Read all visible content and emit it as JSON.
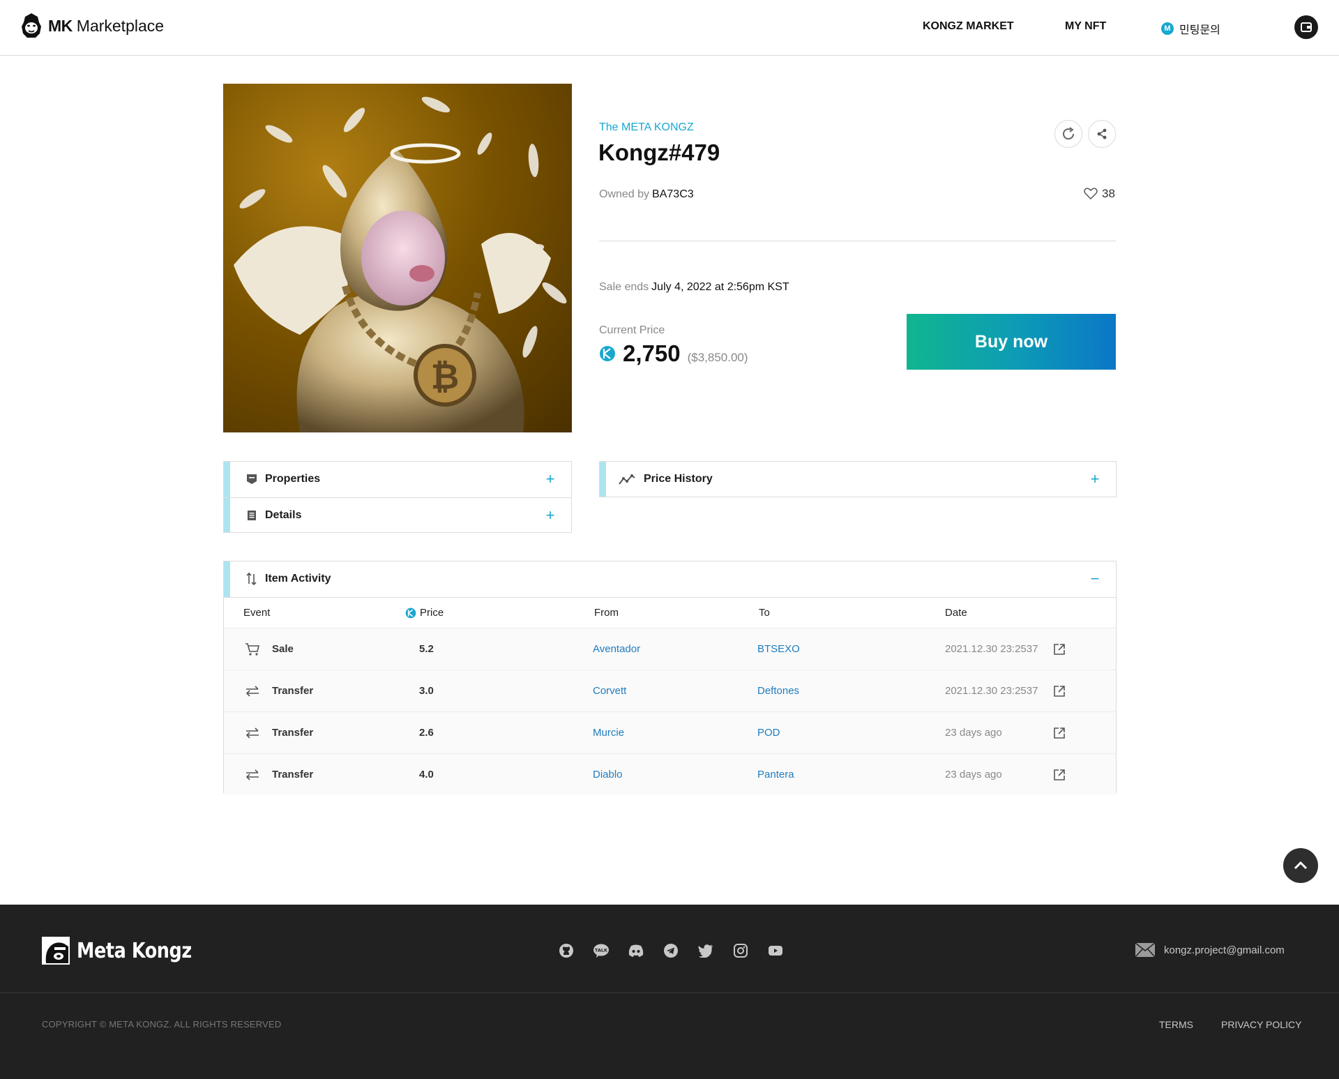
{
  "header": {
    "logo_bold": "MK",
    "logo_text": "Marketplace",
    "nav": {
      "market": "KONGZ MARKET",
      "my_nft": "MY NFT",
      "mint_badge": "M",
      "mint_inquiry": "민팅문의"
    }
  },
  "item": {
    "collection": "The META KONGZ",
    "title": "Kongz#479",
    "owned_by_label": "Owned by",
    "owner": "BA73C3",
    "likes": "38",
    "sale_ends_label": "Sale ends",
    "sale_ends_date": "July 4, 2022 at 2:56pm KST",
    "current_price_label": "Current Price",
    "price": "2,750",
    "price_usd": "($3,850.00)",
    "buy_label": "Buy now"
  },
  "panels": {
    "properties": "Properties",
    "details": "Details",
    "price_history": "Price History",
    "item_activity": "Item Activity",
    "expand_symbol": "+",
    "collapse_symbol": "−"
  },
  "activity": {
    "columns": {
      "event": "Event",
      "price": "Price",
      "from": "From",
      "to": "To",
      "date": "Date"
    },
    "rows": [
      {
        "event": "Sale",
        "icon": "cart-icon",
        "price": "5.2",
        "from": "Aventador",
        "to": "BTSEXO",
        "date": "2021.12.30  23:2537"
      },
      {
        "event": "Transfer",
        "icon": "transfer-icon",
        "price": "3.0",
        "from": "Corvett",
        "to": "Deftones",
        "date": "2021.12.30  23:2537"
      },
      {
        "event": "Transfer",
        "icon": "transfer-icon",
        "price": "2.6",
        "from": "Murcie",
        "to": "POD",
        "date": "23 days ago"
      },
      {
        "event": "Transfer",
        "icon": "transfer-icon",
        "price": "4.0",
        "from": "Diablo",
        "to": "Pantera",
        "date": "23 days ago"
      }
    ]
  },
  "footer": {
    "logo_text": "Meta Kongz",
    "email": "kongz.project@gmail.com",
    "copyright": "COPYRIGHT © META KONGZ.  ALL RIGHTS RESERVED",
    "terms": "TERMS",
    "privacy": "PRIVACY POLICY",
    "socials": [
      "github-icon",
      "kakaotalk-icon",
      "discord-icon",
      "telegram-icon",
      "twitter-icon",
      "instagram-icon",
      "youtube-icon"
    ]
  },
  "colors": {
    "accent": "#19a7cf",
    "link": "#1f7cbf",
    "buy_gradient_start": "#10b58f",
    "buy_gradient_end": "#0b77c7",
    "panel_accent": "#aee4f0",
    "footer_bg": "#212121"
  }
}
